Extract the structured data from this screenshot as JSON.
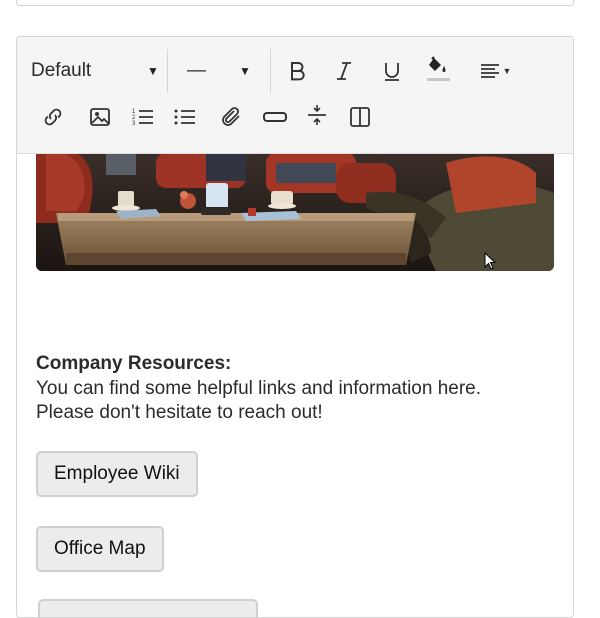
{
  "toolbar": {
    "font_select": "Default",
    "size_select": "—",
    "icons": [
      "bold-icon",
      "italic-icon",
      "underline-icon",
      "fill-color-icon",
      "align-icon",
      "link-icon",
      "image-icon",
      "ordered-list-icon",
      "unordered-list-icon",
      "attachment-icon",
      "button-icon",
      "divider-icon",
      "columns-icon"
    ]
  },
  "content": {
    "heading": "Company Resources:",
    "paragraph_line1": "You can find some helpful links and information here.",
    "paragraph_line2": "Please don't hesitate to reach out!",
    "buttons": [
      {
        "label": "Employee Wiki"
      },
      {
        "label": "Office Map"
      }
    ]
  },
  "colors": {
    "toolbar_bg": "#f5f5f5",
    "button_bg": "#ececec",
    "border": "#d6d6d6"
  }
}
